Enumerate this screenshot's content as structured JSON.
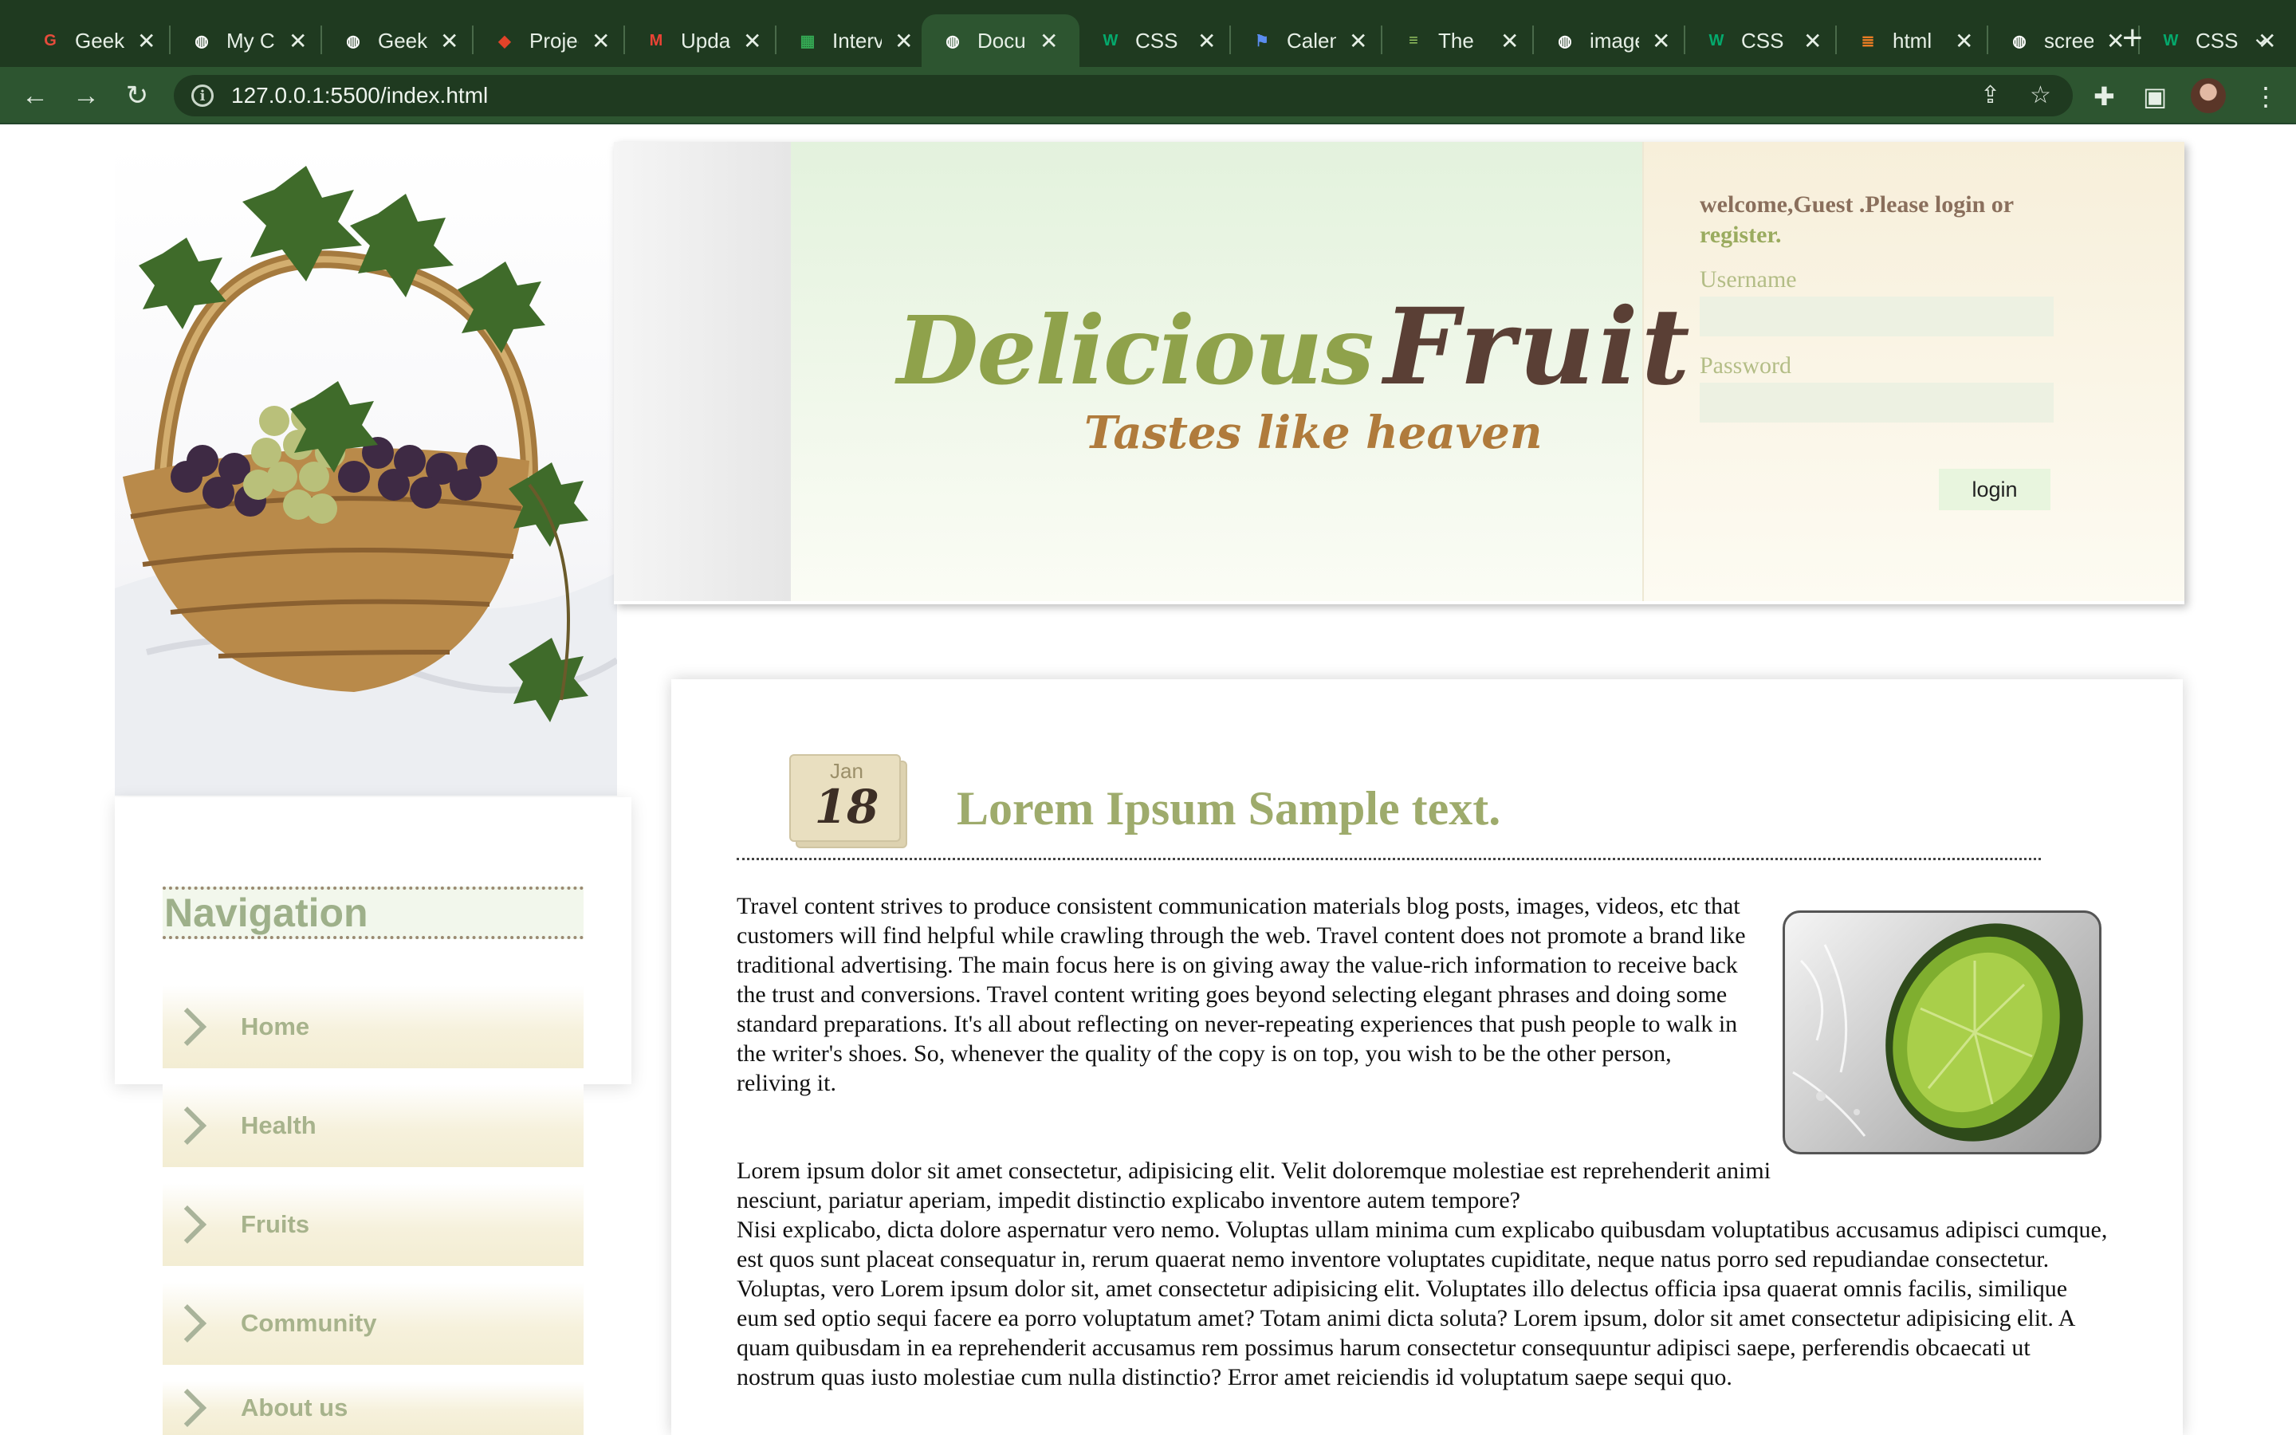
{
  "browser": {
    "tabs": [
      {
        "label": "Geeks",
        "icon": "geeksforgeeks-icon",
        "color": "#e74c3c",
        "active": false
      },
      {
        "label": "My Ch",
        "icon": "globe-icon",
        "color": "#ffffff",
        "active": false
      },
      {
        "label": "Geeks",
        "icon": "globe-icon",
        "color": "#ffffff",
        "active": false
      },
      {
        "label": "Projec",
        "icon": "gitlab-icon",
        "color": "#e24329",
        "active": false
      },
      {
        "label": "Upda",
        "icon": "gmail-icon",
        "color": "#ea4335",
        "active": false
      },
      {
        "label": "Interv",
        "icon": "sheets-icon",
        "color": "#34a853",
        "active": false
      },
      {
        "label": "Docu",
        "icon": "globe-icon",
        "color": "#ffffff",
        "active": true
      },
      {
        "label": "CSS",
        "icon": "w3schools-icon",
        "color": "#04aa6d",
        "active": false
      },
      {
        "label": "Calen",
        "icon": "flag-icon",
        "color": "#5b8def",
        "active": false
      },
      {
        "label": "The",
        "icon": "lines-icon",
        "color": "#9ccc65",
        "active": false
      },
      {
        "label": "image",
        "icon": "globe-icon",
        "color": "#ffffff",
        "active": false
      },
      {
        "label": "CSS",
        "icon": "w3schools-icon",
        "color": "#04aa6d",
        "active": false
      },
      {
        "label": "html",
        "icon": "stackoverflow-icon",
        "color": "#f48024",
        "active": false
      },
      {
        "label": "scree",
        "icon": "globe-icon",
        "color": "#ffffff",
        "active": false
      },
      {
        "label": "CSS",
        "icon": "w3schools-icon",
        "color": "#04aa6d",
        "active": false
      }
    ],
    "url": "127.0.0.1:5500/index.html"
  },
  "header": {
    "logo_word1": "Delicious",
    "logo_word2": "Fruit",
    "tagline": "Tastes like heaven"
  },
  "login": {
    "welcome_text": "welcome,Guest .Please login or",
    "register_link": "register.",
    "username_label": "Username",
    "username_value": "",
    "password_label": "Password",
    "password_value": "",
    "button_label": "login"
  },
  "nav": {
    "title": "Navigation",
    "items": [
      {
        "label": "Home"
      },
      {
        "label": "Health"
      },
      {
        "label": "Fruits"
      },
      {
        "label": "Community"
      },
      {
        "label": "About us"
      }
    ]
  },
  "post": {
    "date_month": "Jan",
    "date_day": "18",
    "title": "Lorem Ipsum Sample text.",
    "paragraph1": "Travel content strives to produce consistent communication materials blog posts, images, videos, etc that customers will find helpful while crawling through the web. Travel content does not promote a brand like traditional advertising. The main focus here is on giving away the value-rich information to receive back the trust and conversions. Travel content writing goes beyond selecting elegant phrases and doing some standard preparations. It's all about reflecting on never-repeating experiences that push people to walk in the writer's shoes. So, whenever the quality of the copy is on top, you wish to be the other person, reliving it.",
    "paragraph2_line1": "Lorem ipsum dolor sit amet consectetur, adipisicing elit. Velit doloremque molestiae est reprehenderit animi nesciunt, pariatur aperiam, impedit distinctio explicabo inventore autem tempore?",
    "paragraph2_line2": "Nisi explicabo, dicta dolore aspernatur vero nemo. Voluptas ullam minima cum explicabo quibusdam voluptatibus accusamus adipisci cumque, est quos sunt placeat consequatur in, rerum quaerat nemo inventore voluptates cupiditate, neque natus porro sed repudiandae consectetur. Voluptas, vero Lorem ipsum dolor sit, amet consectetur adipisicing elit. Voluptates illo delectus officia ipsa quaerat omnis facilis, similique eum sed optio sequi facere ea porro voluptatum amet? Totam animi dicta soluta? Lorem ipsum, dolor sit amet consectetur adipisicing elit. A quam quibusdam in ea reprehenderit accusamus rem possimus harum consectetur consequuntur adipisci saepe, perferendis obcaecati ut nostrum quas iusto molestiae cum nulla distinctio? Error amet reiciendis id voluptatum saepe sequi quo."
  },
  "colors": {
    "chrome_dark": "#1f3a20",
    "chrome_active": "#2d5530",
    "logo_green": "#8fa24b",
    "logo_brown": "#5a3f35",
    "tagline_orange": "#b07b3c",
    "title_green": "#9eab6c"
  }
}
